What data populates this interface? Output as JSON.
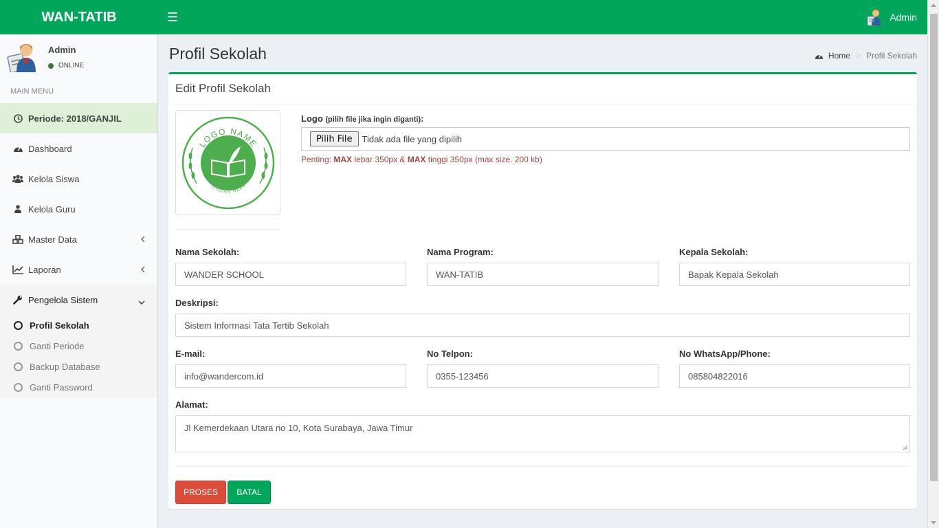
{
  "app": {
    "brand": "WAN-TATIB",
    "user": "Admin"
  },
  "sidebar": {
    "user_name": "Admin",
    "status": "ONLINE",
    "menu_header": "MAIN MENU",
    "period": "Periode: 2018/GANJIL",
    "items": [
      {
        "label": "Dashboard",
        "icon": "dashboard-icon"
      },
      {
        "label": "Kelola Siswa",
        "icon": "users-icon"
      },
      {
        "label": "Kelola Guru",
        "icon": "user-icon"
      },
      {
        "label": "Master Data",
        "icon": "cubes-icon"
      },
      {
        "label": "Laporan",
        "icon": "line-chart-icon"
      },
      {
        "label": "Pengelola Sistem",
        "icon": "wrench-icon"
      }
    ],
    "subitems": [
      "Profil Sekolah",
      "Ganti Periode",
      "Backup Database",
      "Ganti Password"
    ]
  },
  "page": {
    "title": "Profil Sekolah",
    "breadcrumb": {
      "home": "Home",
      "current": "Profil Sekolah"
    }
  },
  "form": {
    "box_title": "Edit Profil Sekolah",
    "logo_label": "Logo",
    "logo_hint": "(pilih file jika ingin diganti)",
    "logo_colon": ":",
    "logo_text_top": "LOGO NAME",
    "logo_text_bottom": "SLOGAN HERE",
    "file_button": "Pilih File",
    "file_status": "Tidak ada file yang dipilih",
    "help": {
      "prefix": "Penting: ",
      "max1": "MAX",
      "mid": " lebar 350px & ",
      "max2": "MAX",
      "suffix": " tinggi 350px (max size. 200 kb)"
    },
    "fields": {
      "nama_sekolah": {
        "label": "Nama Sekolah:",
        "value": "WANDER SCHOOL"
      },
      "nama_program": {
        "label": "Nama Program:",
        "value": "WAN-TATIB"
      },
      "kepala_sekolah": {
        "label": "Kepala Sekolah:",
        "value": "Bapak Kepala Sekolah"
      },
      "deskripsi": {
        "label": "Deskripsi:",
        "value": "Sistem Informasi Tata Tertib Sekolah"
      },
      "email": {
        "label": "E-mail:",
        "value": "info@wandercom.id"
      },
      "telpon": {
        "label": "No Telpon:",
        "value": "0355-123456"
      },
      "whatsapp": {
        "label": "No WhatsApp/Phone:",
        "value": "085804822016"
      },
      "alamat": {
        "label": "Alamat:",
        "value": "Jl Kemerdekaan Utara no 10, Kota Surabaya, Jawa Timur"
      }
    },
    "buttons": {
      "submit": "PROSES",
      "cancel": "BATAL"
    }
  },
  "colors": {
    "brand_green": "#00a65a",
    "danger": "#dd4b39",
    "help_text": "#a94442",
    "period_bg": "#dff0d8"
  }
}
